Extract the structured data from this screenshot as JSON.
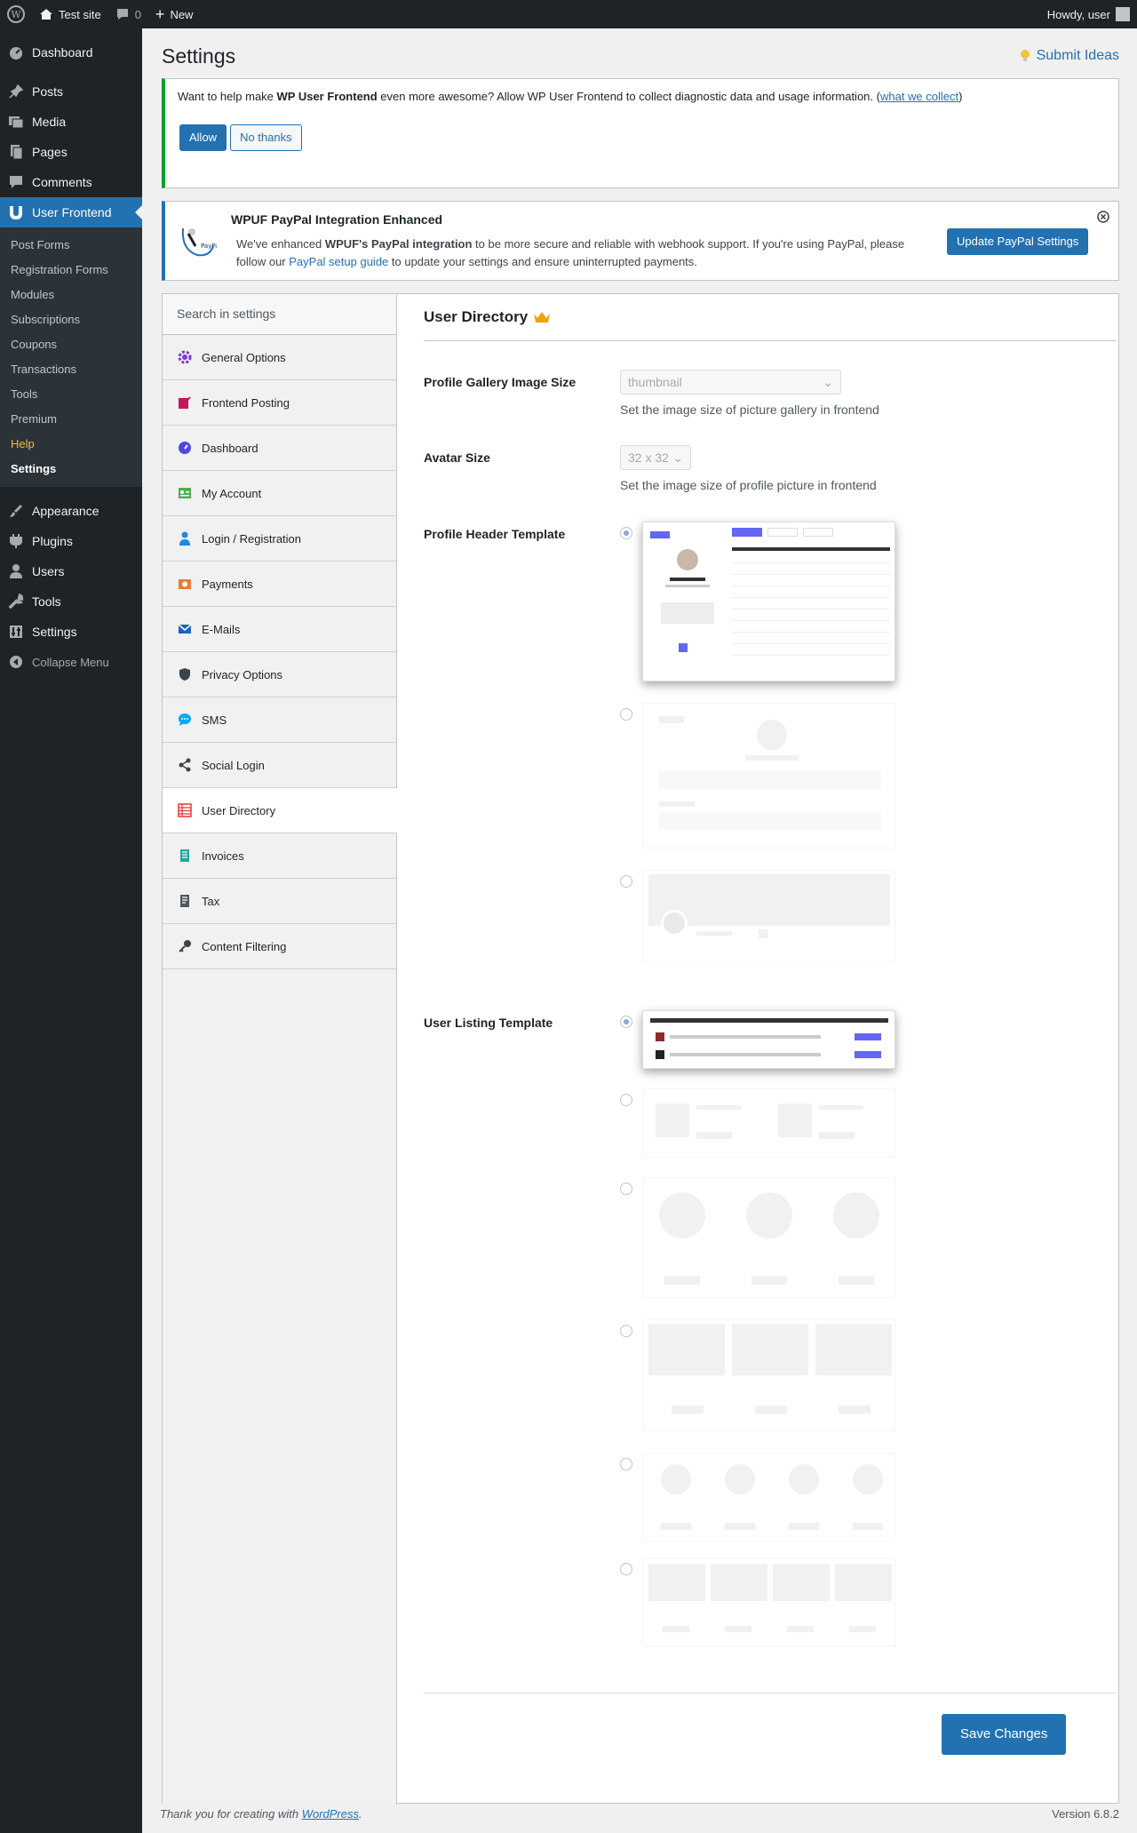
{
  "adminbar": {
    "site": "Test site",
    "comments": "0",
    "new": "New",
    "howdy": "Howdy, user"
  },
  "sidebar": {
    "items": [
      "Dashboard",
      "Posts",
      "Media",
      "Pages",
      "Comments",
      "User Frontend"
    ],
    "submenu": [
      "Post Forms",
      "Registration Forms",
      "Modules",
      "Subscriptions",
      "Coupons",
      "Transactions",
      "Tools",
      "Premium",
      "Help",
      "Settings"
    ],
    "items2": [
      "Appearance",
      "Plugins",
      "Users",
      "Tools",
      "Settings"
    ],
    "collapse": "Collapse Menu"
  },
  "page": {
    "title": "Settings",
    "submit_ideas": "Submit Ideas"
  },
  "notice1": {
    "pre": "Want to help make ",
    "bold": "WP User Frontend",
    "post": " even more awesome? Allow WP User Frontend to collect diagnostic data and usage information. (",
    "link": "what we collect",
    "end": ")",
    "allow": "Allow",
    "no_thanks": "No thanks"
  },
  "notice2": {
    "title": "WPUF PayPal Integration Enhanced",
    "t1": "We've enhanced ",
    "bold": "WPUF's PayPal integration",
    "t2": " to be more secure and reliable with webhook support. If you're using PayPal, please follow our ",
    "link": "PayPal setup guide",
    "t3": " to update your settings and ensure uninterrupted payments.",
    "button": "Update PayPal Settings"
  },
  "settings_nav": {
    "search_placeholder": "Search in settings",
    "items": [
      "General Options",
      "Frontend Posting",
      "Dashboard",
      "My Account",
      "Login / Registration",
      "Payments",
      "E-Mails",
      "Privacy Options",
      "SMS",
      "Social Login",
      "User Directory",
      "Invoices",
      "Tax",
      "Content Filtering"
    ]
  },
  "section": {
    "title": "User Directory",
    "gallery_label": "Profile Gallery Image Size",
    "gallery_value": "thumbnail",
    "gallery_desc": "Set the image size of picture gallery in frontend",
    "avatar_label": "Avatar Size",
    "avatar_value": "32 x 32",
    "avatar_desc": "Set the image size of profile picture in frontend",
    "header_label": "Profile Header Template",
    "listing_label": "User Listing Template",
    "save": "Save Changes"
  },
  "footer": {
    "pre": "Thank you for creating with ",
    "link": "WordPress",
    "post": ".",
    "version": "Version 6.8.2"
  }
}
